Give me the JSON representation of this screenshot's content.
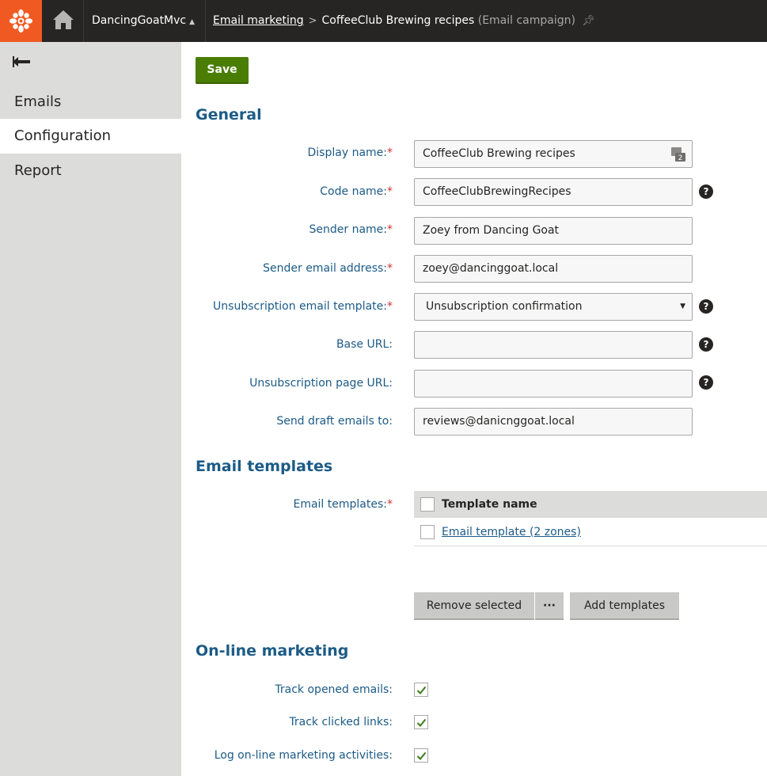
{
  "header": {
    "site_name": "DancingGoatMvc",
    "breadcrumb_parent": "Email marketing",
    "breadcrumb_current": "CoffeeClub Brewing recipes",
    "breadcrumb_type": "(Email campaign)"
  },
  "sidebar": {
    "items": [
      {
        "label": "Emails"
      },
      {
        "label": "Configuration"
      },
      {
        "label": "Report"
      }
    ]
  },
  "toolbar": {
    "save_label": "Save"
  },
  "general": {
    "title": "General",
    "fields": {
      "display_name": {
        "label": "Display name:",
        "required": "*",
        "value": "CoffeeClub Brewing recipes"
      },
      "code_name": {
        "label": "Code name:",
        "required": "*",
        "value": "CoffeeClubBrewingRecipes"
      },
      "sender_name": {
        "label": "Sender name:",
        "required": "*",
        "value": "Zoey from Dancing Goat"
      },
      "sender_email": {
        "label": "Sender email address:",
        "required": "*",
        "value": "zoey@dancinggoat.local"
      },
      "unsub_template": {
        "label": "Unsubscription email template:",
        "required": "*",
        "value": "Unsubscription confirmation"
      },
      "base_url": {
        "label": "Base URL:",
        "value": ""
      },
      "unsub_page_url": {
        "label": "Unsubscription page URL:",
        "value": ""
      },
      "draft_emails": {
        "label": "Send draft emails to:",
        "value": "reviews@danicnggoat.local"
      }
    }
  },
  "templates": {
    "title": "Email templates",
    "label": "Email templates:",
    "required": "*",
    "column_header": "Template name",
    "rows": [
      {
        "name": "Email template (2 zones)"
      }
    ],
    "remove_label": "Remove selected",
    "more_label": "···",
    "add_label": "Add templates"
  },
  "marketing": {
    "title": "On-line marketing",
    "track_opened": {
      "label": "Track opened emails:",
      "checked": true
    },
    "track_clicked": {
      "label": "Track clicked links:",
      "checked": true
    },
    "log_activities": {
      "label": "Log on-line marketing activities:",
      "checked": true
    }
  },
  "colors": {
    "brand_orange": "#f05a22",
    "topbar": "#262524",
    "label_blue": "#1c5b87",
    "save_green": "#497d04",
    "required_red": "#d62e2e"
  }
}
